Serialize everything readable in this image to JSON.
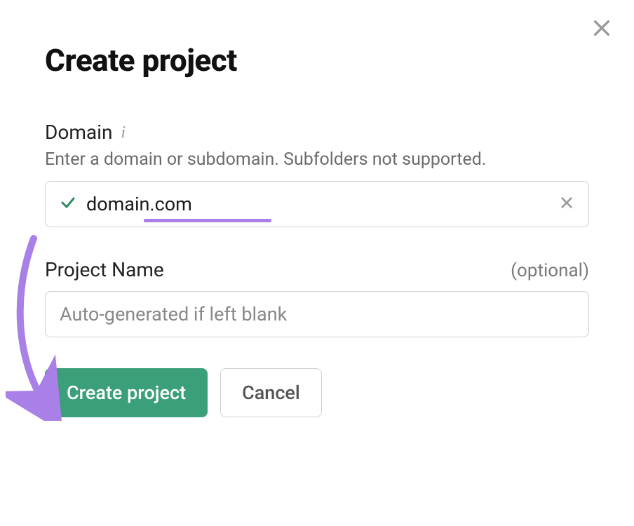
{
  "dialog": {
    "title": "Create project",
    "close_label": "Close"
  },
  "domain_field": {
    "label": "Domain",
    "help": "Enter a domain or subdomain. Subfolders not supported.",
    "value": "domain.com",
    "info_icon": "info-icon",
    "valid": true
  },
  "name_field": {
    "label": "Project Name",
    "optional_tag": "(optional)",
    "placeholder": "Auto-generated if left blank",
    "value": ""
  },
  "actions": {
    "primary": "Create project",
    "secondary": "Cancel"
  }
}
